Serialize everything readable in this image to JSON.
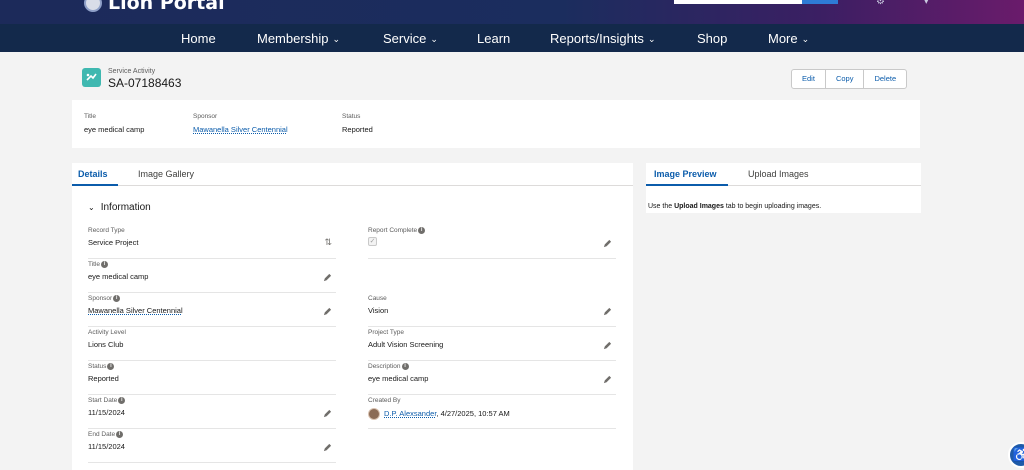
{
  "brand": {
    "logo_text": "Lion Portal"
  },
  "nav": {
    "items": [
      {
        "label": "Home",
        "chevron": false
      },
      {
        "label": "Membership",
        "chevron": true
      },
      {
        "label": "Service",
        "chevron": true
      },
      {
        "label": "Learn",
        "chevron": false
      },
      {
        "label": "Reports/Insights",
        "chevron": true
      },
      {
        "label": "Shop",
        "chevron": false
      },
      {
        "label": "More",
        "chevron": true
      }
    ]
  },
  "record": {
    "type_label": "Service Activity",
    "name": "SA-07188463",
    "actions": {
      "edit": "Edit",
      "copy": "Copy",
      "delete": "Delete"
    }
  },
  "highlights": {
    "title_label": "Title",
    "title_value": "eye medical camp",
    "sponsor_label": "Sponsor",
    "sponsor_value": "Mawanella Silver Centennial",
    "status_label": "Status",
    "status_value": "Reported"
  },
  "details_tabs": {
    "details": "Details",
    "gallery": "Image Gallery"
  },
  "section": {
    "title": "Information"
  },
  "fields": {
    "record_type": {
      "label": "Record Type",
      "value": "Service Project"
    },
    "report_complete": {
      "label": "Report Complete",
      "value": "✓"
    },
    "title": {
      "label": "Title",
      "value": "eye medical camp"
    },
    "sponsor": {
      "label": "Sponsor",
      "value": "Mawanella Silver Centennial"
    },
    "cause": {
      "label": "Cause",
      "value": "Vision"
    },
    "activity_level": {
      "label": "Activity Level",
      "value": "Lions Club"
    },
    "project_type": {
      "label": "Project Type",
      "value": "Adult Vision Screening"
    },
    "status": {
      "label": "Status",
      "value": "Reported"
    },
    "description": {
      "label": "Description",
      "value": "eye medical camp"
    },
    "start_date": {
      "label": "Start Date",
      "value": "11/15/2024"
    },
    "created_by": {
      "label": "Created By",
      "user": "D.P. Alexsander",
      "timestamp": ", 4/27/2025, 10:57 AM"
    },
    "end_date": {
      "label": "End Date",
      "value": "11/15/2024"
    }
  },
  "preview_tabs": {
    "preview": "Image Preview",
    "upload": "Upload Images"
  },
  "preview": {
    "text_before": "Use the ",
    "text_bold": "Upload Images",
    "text_after": " tab to begin uploading images."
  },
  "colors": {
    "accent": "#0b5cab",
    "nav_bg": "#13294b",
    "record_icon": "#3fb8b0"
  },
  "icons": [
    "lion-logo-icon",
    "service-activity-icon",
    "pencil-icon",
    "swap-icon",
    "info-icon",
    "chevron-down-icon",
    "accessibility-icon"
  ]
}
